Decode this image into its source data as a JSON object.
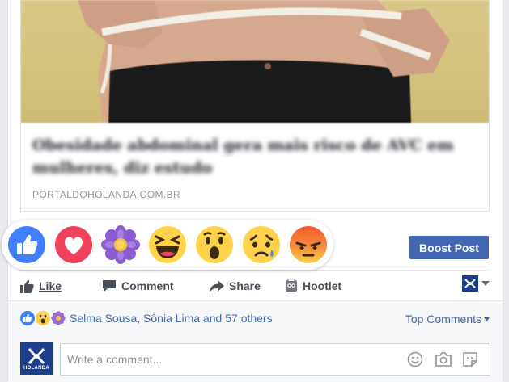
{
  "link_preview": {
    "title": "Obesidade abdominal gera mais risco de AVC em mulheres, diz estudo",
    "domain": "PORTALDOHOLANDA.COM.BR"
  },
  "reactions": [
    {
      "name": "like",
      "color": "#4080ff"
    },
    {
      "name": "love",
      "color": "#f0435b"
    },
    {
      "name": "thankful",
      "color": "#8a5ccf"
    },
    {
      "name": "haha",
      "color": "#ffd24a"
    },
    {
      "name": "wow",
      "color": "#ffd24a"
    },
    {
      "name": "sad",
      "color": "#ffd24a"
    },
    {
      "name": "angry",
      "color": "#f05a2d"
    }
  ],
  "boost_button": "Boost Post",
  "actions": {
    "like": "Like",
    "comment": "Comment",
    "share": "Share",
    "hootlet": "Hootlet"
  },
  "page_avatar_label": "HOLANDA",
  "summary": {
    "names": "Selma Sousa, Sônia Lima and 57 others",
    "sort": "Top Comments"
  },
  "comment": {
    "placeholder": "Write a comment..."
  },
  "colors": {
    "brand_blue": "#4267b2",
    "link_blue": "#4267b2",
    "text_gray": "#4b4f56",
    "avatar_bg": "#1c3e8c"
  }
}
